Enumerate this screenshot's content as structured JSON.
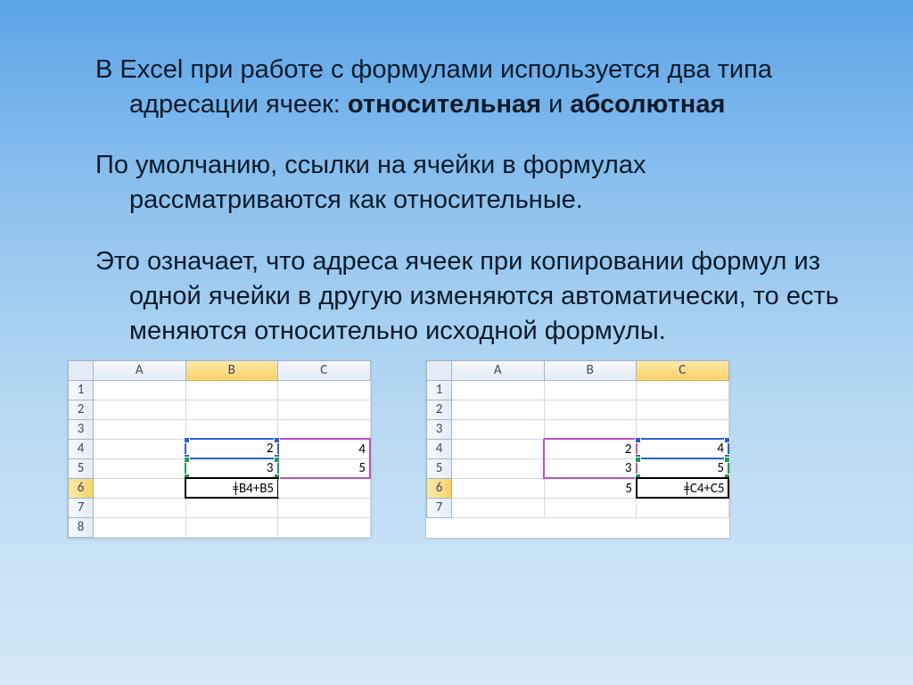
{
  "para1_a": "В Excel при работе с формулами используется два типа адресации ячеек: ",
  "para1_b": "относительная",
  "para1_c": " и ",
  "para1_d": "абсолютная",
  "para2": "По умолчанию, ссылки на ячейки в формулах рассматриваются как относительные.",
  "para3": "Это означает, что адреса ячеек при копировании формул из одной ячейки в другую изменяются автоматически, то есть меняются относительно исходной формулы.",
  "sheet1": {
    "cols": [
      "A",
      "B",
      "C"
    ],
    "rows": [
      "1",
      "2",
      "3",
      "4",
      "5",
      "6",
      "7",
      "8"
    ],
    "B4": "2",
    "C4": "4",
    "B5": "3",
    "C5": "5",
    "B6": "=B4+B5"
  },
  "sheet2": {
    "cols": [
      "A",
      "B",
      "C"
    ],
    "rows": [
      "1",
      "2",
      "3",
      "4",
      "5",
      "6",
      "7"
    ],
    "B4": "2",
    "C4": "4",
    "B5": "3",
    "C5": "5",
    "B6": "5",
    "C6": "=C4+C5"
  }
}
